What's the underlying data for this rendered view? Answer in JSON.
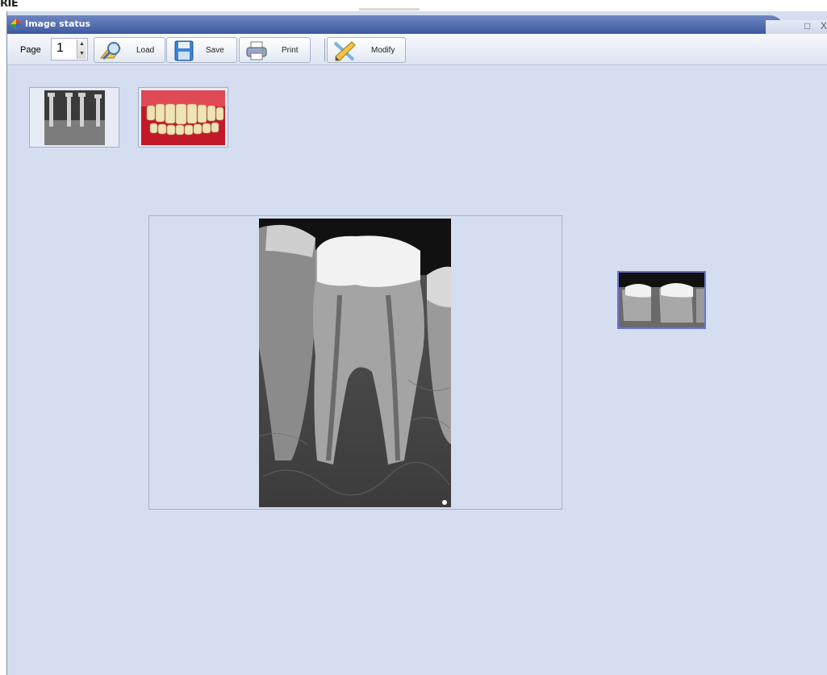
{
  "window": {
    "title": "Image status"
  },
  "top_fragment": {
    "text": "RIE"
  },
  "toolbar": {
    "page_label": "Page",
    "page_value": "1",
    "load_label": "Load",
    "save_label": "Save",
    "print_label": "Print",
    "modify_label": "Modify"
  },
  "window_buttons": {
    "restore": "□",
    "close": "X"
  },
  "images": {
    "thumbnails": [
      "implant-xray-thumbnail",
      "teeth-photo-thumbnail",
      "bitewing-xray-thumbnail"
    ],
    "main": "molar-periapical-xray"
  },
  "colors": {
    "title_bar": "#3d5aa0",
    "workspace": "#d5def0",
    "selected_border": "#6b73d6"
  }
}
